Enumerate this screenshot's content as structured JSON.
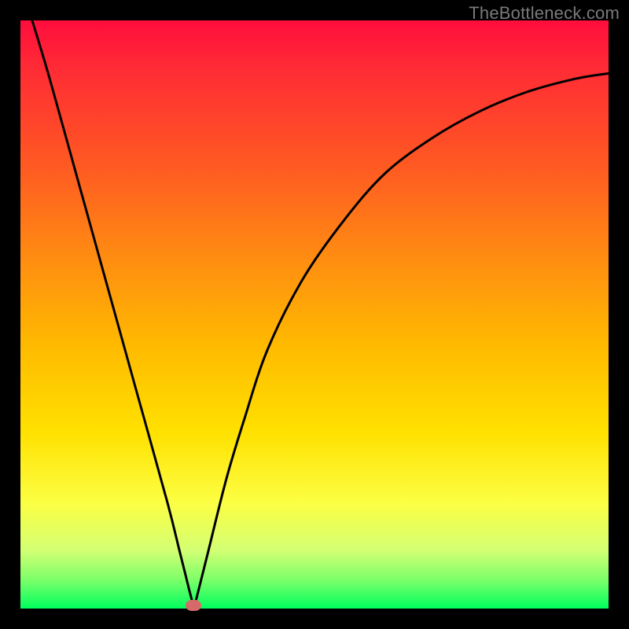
{
  "watermark": "TheBottleneck.com",
  "chart_data": {
    "type": "line",
    "title": "",
    "xlabel": "",
    "ylabel": "",
    "xlim": [
      0,
      100
    ],
    "ylim": [
      0,
      100
    ],
    "grid": false,
    "legend": false,
    "series": [
      {
        "name": "curve",
        "color": "#000000",
        "x": [
          2,
          5,
          10,
          15,
          20,
          25,
          27,
          28,
          29,
          29.5,
          30,
          32,
          35,
          38,
          42,
          48,
          55,
          62,
          70,
          78,
          86,
          94,
          100
        ],
        "y": [
          100,
          90,
          72,
          54,
          36,
          18,
          10,
          6,
          2,
          0.5,
          2,
          10,
          22,
          32,
          44,
          56,
          66,
          74,
          80,
          84.5,
          87.8,
          90,
          91
        ]
      }
    ],
    "marker": {
      "name": "optimal-point",
      "x": 29.4,
      "y": 0.5,
      "color": "#d66a6a"
    },
    "gradient_stops": [
      {
        "pos": 0.0,
        "color": "#ff0d3d"
      },
      {
        "pos": 0.08,
        "color": "#ff2b35"
      },
      {
        "pos": 0.25,
        "color": "#ff5a22"
      },
      {
        "pos": 0.4,
        "color": "#ff8b12"
      },
      {
        "pos": 0.55,
        "color": "#ffb900"
      },
      {
        "pos": 0.7,
        "color": "#ffe100"
      },
      {
        "pos": 0.82,
        "color": "#fcff43"
      },
      {
        "pos": 0.9,
        "color": "#d4ff73"
      },
      {
        "pos": 0.95,
        "color": "#7fff6a"
      },
      {
        "pos": 1.0,
        "color": "#00ff5e"
      }
    ]
  }
}
